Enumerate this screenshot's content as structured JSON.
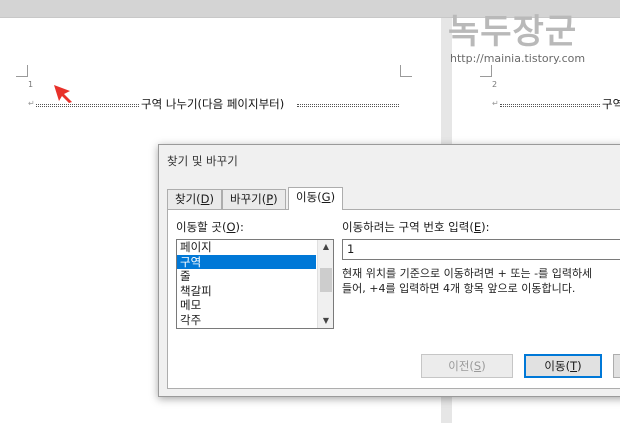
{
  "watermark": {
    "title": "녹두장군",
    "url": "http://mainia.tistory.com"
  },
  "document": {
    "page1": {
      "page_number_mark": "1",
      "section_break_label": "구역 나누기(다음 페이지부터)"
    },
    "page2": {
      "page_number_mark": "2",
      "section_break_label": "구역"
    }
  },
  "dialog": {
    "title": "찾기 및 바꾸기",
    "tabs": [
      {
        "label": "찾기(",
        "key": "D",
        "suffix": ")"
      },
      {
        "label": "바꾸기(",
        "key": "P",
        "suffix": ")"
      },
      {
        "label": "이동(",
        "key": "G",
        "suffix": ")"
      }
    ],
    "goto_what": {
      "label": "이동할 곳(",
      "key": "O",
      "suffix": "):",
      "items": [
        "페이지",
        "구역",
        "줄",
        "책갈피",
        "메모",
        "각주"
      ],
      "selected": "구역"
    },
    "enter_number": {
      "label": "이동하려는 구역 번호 입력(",
      "key": "E",
      "suffix": "):",
      "value": "1"
    },
    "help_text_1": "현재 위치를 기준으로 이동하려면 + 또는 -를 입력하세",
    "help_text_2": "들어, +4를 입력하면 4개 항목 앞으로 이동합니다.",
    "buttons": {
      "previous": {
        "label": "이전(",
        "key": "S",
        "suffix": ")"
      },
      "goto": {
        "label": "이동(",
        "key": "T",
        "suffix": ")"
      }
    }
  },
  "colors": {
    "selection": "#0078d7",
    "arrow": "#e8312a"
  }
}
